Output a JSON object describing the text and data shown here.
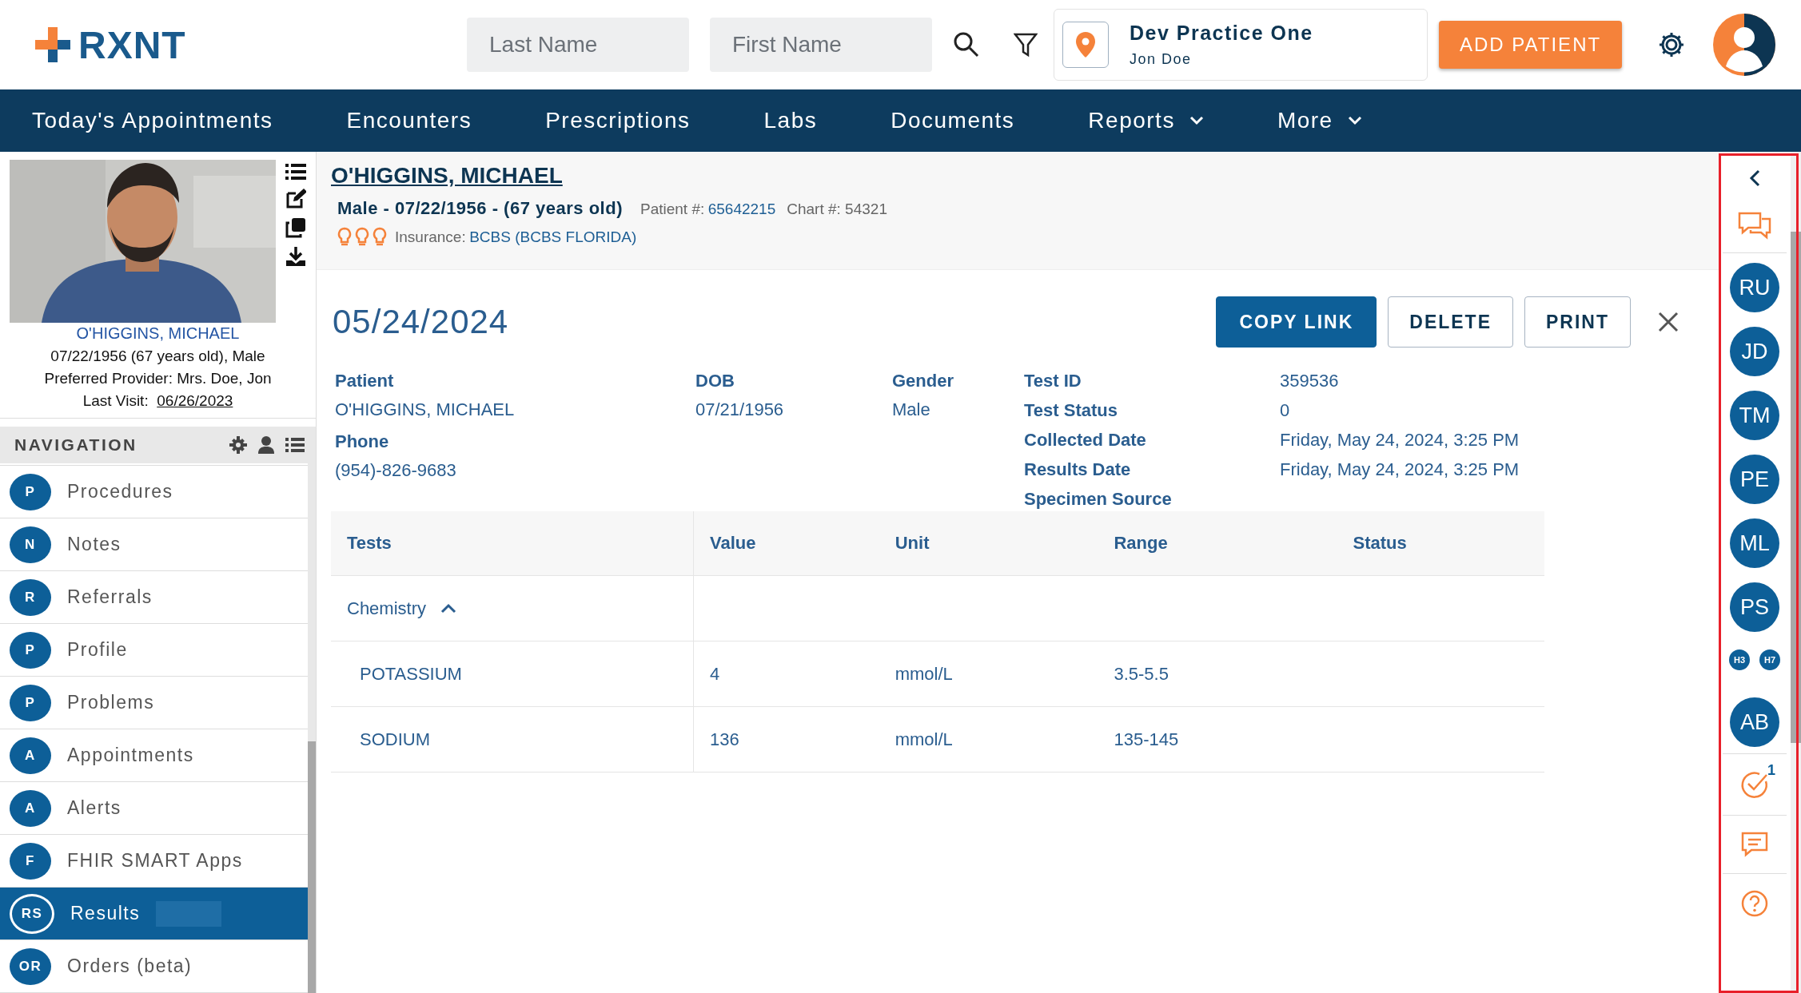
{
  "header": {
    "logo": "RXNT",
    "last_name": {
      "placeholder": "Last Name"
    },
    "first_name": {
      "placeholder": "First Name"
    },
    "practice": {
      "name": "Dev Practice One",
      "user": "Jon Doe"
    },
    "add_button": "ADD PATIENT"
  },
  "menu": [
    {
      "label": "Today's Appointments",
      "dropdown": false
    },
    {
      "label": "Encounters",
      "dropdown": false
    },
    {
      "label": "Prescriptions",
      "dropdown": false
    },
    {
      "label": "Labs",
      "dropdown": false
    },
    {
      "label": "Documents",
      "dropdown": false
    },
    {
      "label": "Reports",
      "dropdown": true
    },
    {
      "label": "More",
      "dropdown": true
    }
  ],
  "patient_card": {
    "name": "O'HIGGINS, MICHAEL",
    "dob_line": "07/22/1956 (67 years old), Male",
    "provider": "Preferred Provider: Mrs. Doe, Jon",
    "last_visit_label": "Last Visit:",
    "last_visit": "06/26/2023"
  },
  "navigation": {
    "title": "NAVIGATION",
    "items": [
      {
        "badge": "P",
        "label": "Procedures",
        "selected": false
      },
      {
        "badge": "N",
        "label": "Notes",
        "selected": false
      },
      {
        "badge": "R",
        "label": "Referrals",
        "selected": false
      },
      {
        "badge": "P",
        "label": "Profile",
        "selected": false
      },
      {
        "badge": "P",
        "label": "Problems",
        "selected": false
      },
      {
        "badge": "A",
        "label": "Appointments",
        "selected": false
      },
      {
        "badge": "A",
        "label": "Alerts",
        "selected": false
      },
      {
        "badge": "F",
        "label": "FHIR SMART Apps",
        "selected": false
      },
      {
        "badge": "RS",
        "label": "Results",
        "selected": true
      },
      {
        "badge": "OR",
        "label": "Orders (beta)",
        "selected": false
      }
    ]
  },
  "patient_header": {
    "name": "O'HIGGINS, MICHAEL",
    "summary": "Male - 07/22/1956 - (67 years old)",
    "patient_no_label": "Patient #:",
    "patient_no": "65642215",
    "chart": "Chart #: 54321",
    "insurance_label": "Insurance:",
    "insurance": "BCBS (BCBS FLORIDA)"
  },
  "result": {
    "date": "05/24/2024",
    "buttons": [
      {
        "label": "COPY LINK",
        "primary": true
      },
      {
        "label": "DELETE",
        "primary": false
      },
      {
        "label": "PRINT",
        "primary": false
      }
    ],
    "columns": [
      [
        {
          "label": "Patient",
          "value": "O'HIGGINS, MICHAEL"
        },
        {
          "label": "Phone",
          "value": "(954)-826-9683"
        }
      ],
      [
        {
          "label": "DOB",
          "value": "07/21/1956"
        }
      ],
      [
        {
          "label": "Gender",
          "value": "Male"
        }
      ]
    ],
    "test_fields": [
      {
        "label": "Test ID",
        "value": "359536"
      },
      {
        "label": "Test Status",
        "value": "0"
      },
      {
        "label": "Collected Date",
        "value": "Friday, May 24, 2024, 3:25 PM"
      },
      {
        "label": "Results Date",
        "value": "Friday, May 24, 2024, 3:25 PM"
      },
      {
        "label": "Specimen Source"
      }
    ]
  },
  "table": {
    "columns": [
      "Tests",
      "Value",
      "Unit",
      "Range",
      "Status"
    ],
    "groups": [
      {
        "name": "Chemistry",
        "expanded": true,
        "rows": [
          {
            "test": "POTASSIUM",
            "value": "4",
            "unit": "mmol/L",
            "range": "3.5-5.5"
          },
          {
            "test": "SODIUM",
            "value": "136",
            "unit": "mmol/L",
            "range": "135-145"
          }
        ]
      }
    ]
  },
  "right_panel": {
    "avatars": [
      {
        "initials": "RU",
        "kind": "large"
      },
      {
        "initials": "JD",
        "kind": "large"
      },
      {
        "initials": "TM",
        "kind": "large"
      },
      {
        "initials": "PE",
        "kind": "large"
      },
      {
        "initials": "ML",
        "kind": "large"
      },
      {
        "initials": "PS",
        "kind": "large"
      },
      {
        "initials": "H3",
        "kind": "small"
      },
      {
        "initials": "H7",
        "kind": "small"
      },
      {
        "initials": "AB",
        "kind": "large"
      }
    ],
    "task_count": "1"
  }
}
